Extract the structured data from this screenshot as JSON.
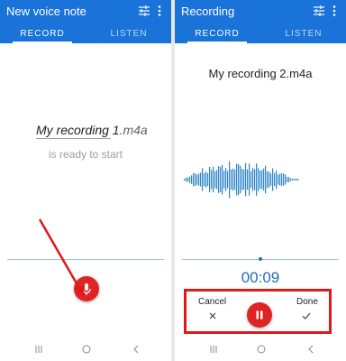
{
  "left": {
    "appbar": {
      "title": "New voice note",
      "tune_icon": "tune-icon",
      "more_icon": "more-vert-icon"
    },
    "tabs": [
      {
        "label": "RECORD",
        "active": true
      },
      {
        "label": "LISTEN",
        "active": false
      }
    ],
    "filename": {
      "name": "My recording 1",
      "ext": ".m4a"
    },
    "status": "is ready to start",
    "mic_icon": "microphone-icon"
  },
  "right": {
    "appbar": {
      "title": "Recording",
      "tune_icon": "tune-icon",
      "more_icon": "more-vert-icon"
    },
    "tabs": [
      {
        "label": "RECORD",
        "active": true
      },
      {
        "label": "LISTEN",
        "active": false
      }
    ],
    "filename": "My recording 2.m4a",
    "timer": "00:09",
    "controls": {
      "cancel_label": "Cancel",
      "done_label": "Done",
      "pause_icon": "pause-icon",
      "cancel_icon": "close-icon",
      "done_icon": "check-icon"
    }
  },
  "navbar": {
    "icons": [
      "recent-apps-icon",
      "home-icon",
      "back-icon"
    ]
  },
  "colors": {
    "appbar": "#1a73d9",
    "record_button": "#e02424",
    "annotation": "#e01818",
    "timer": "#1f6fb4"
  }
}
